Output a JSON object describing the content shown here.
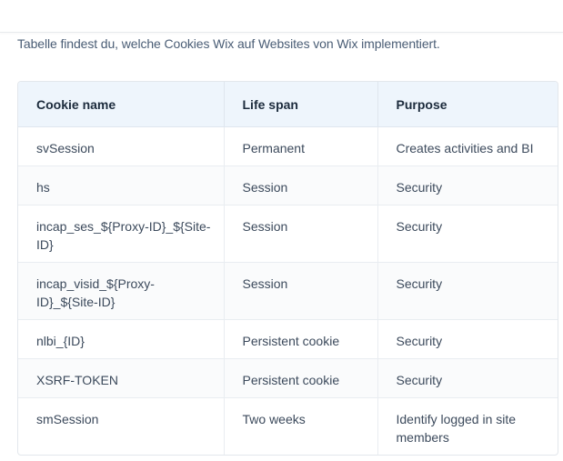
{
  "intro_text": "Tabelle findest du, welche Cookies Wix auf Websites von Wix implementiert.",
  "table": {
    "headers": {
      "name": "Cookie name",
      "life_span": "Life span",
      "purpose": "Purpose"
    },
    "rows": [
      {
        "name": "svSession",
        "life_span": "Permanent",
        "purpose": "Creates activities and BI"
      },
      {
        "name": "hs",
        "life_span": "Session",
        "purpose": "Security"
      },
      {
        "name": "incap_ses_${Proxy-ID}_${Site-ID}",
        "life_span": "Session",
        "purpose": "Security"
      },
      {
        "name": "incap_visid_${Proxy-ID}_${Site-ID}",
        "life_span": "Session",
        "purpose": "Security"
      },
      {
        "name": "nlbi_{ID}",
        "life_span": "Persistent cookie",
        "purpose": "Security"
      },
      {
        "name": "XSRF-TOKEN",
        "life_span": "Persistent cookie",
        "purpose": "Security"
      },
      {
        "name": "smSession",
        "life_span": "Two weeks",
        "purpose": "Identify logged in site members"
      }
    ]
  },
  "colors": {
    "header_bg": "#eef5fc",
    "text": "#3c4a5c",
    "border": "#e3e7ec"
  }
}
